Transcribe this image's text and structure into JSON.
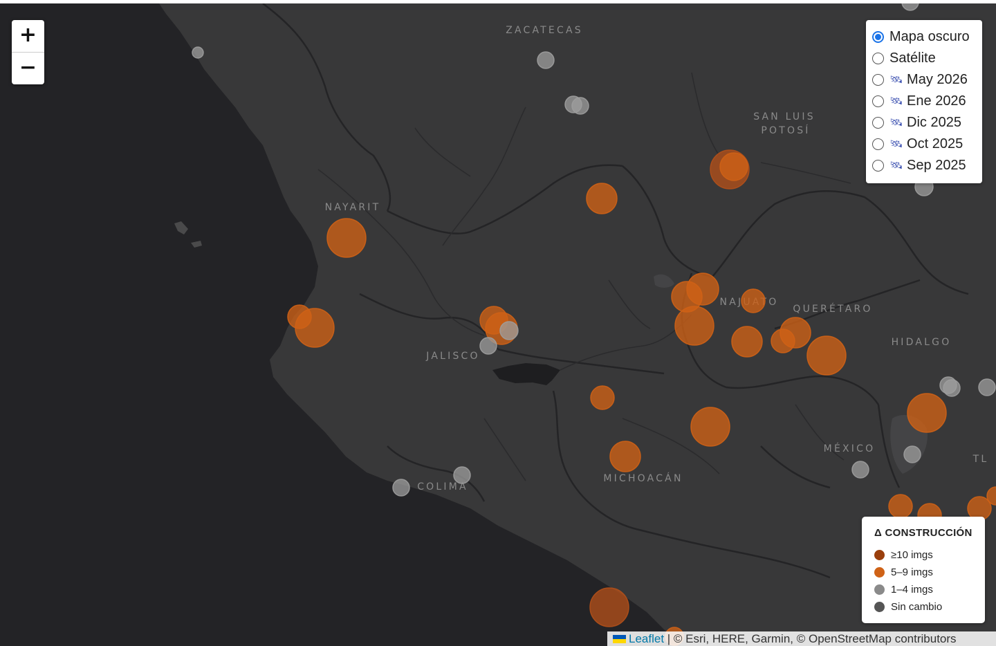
{
  "map": {
    "states": [
      {
        "label": "ZACATECAS",
        "lines": [
          "ZACATECAS"
        ]
      },
      {
        "label": "SAN LUIS POTOSÍ",
        "lines": [
          "SAN LUIS",
          "POTOSÍ"
        ]
      },
      {
        "label": "NAYARIT",
        "lines": [
          "NAYARIT"
        ]
      },
      {
        "label": "GUANAJUATO",
        "lines": [
          "NAJUATO"
        ]
      },
      {
        "label": "QUERÉTARO",
        "lines": [
          "QUERÉTARO"
        ]
      },
      {
        "label": "JALISCO",
        "lines": [
          "JALISCO"
        ]
      },
      {
        "label": "HIDALGO",
        "lines": [
          "HIDALGO"
        ]
      },
      {
        "label": "MÉXICO",
        "lines": [
          "MÉXICO"
        ]
      },
      {
        "label": "MICHOACÁN",
        "lines": [
          "MICHOACÁN"
        ]
      },
      {
        "label": "COLIMA",
        "lines": [
          "COLIMA"
        ]
      },
      {
        "label": "TLAXCALA",
        "lines": [
          "TL"
        ]
      }
    ]
  },
  "zoom": {
    "in_label": "+",
    "out_label": "−"
  },
  "layers": {
    "selected": "Mapa oscuro",
    "items": [
      {
        "label": "Mapa oscuro",
        "icon": "",
        "selected": true
      },
      {
        "label": "Satélite",
        "icon": "",
        "selected": false
      },
      {
        "label": "May 2026",
        "icon": "satellite-icon",
        "selected": false
      },
      {
        "label": "Ene 2026",
        "icon": "satellite-icon",
        "selected": false
      },
      {
        "label": "Dic 2025",
        "icon": "satellite-icon",
        "selected": false
      },
      {
        "label": "Oct 2025",
        "icon": "satellite-icon",
        "selected": false
      },
      {
        "label": "Sep 2025",
        "icon": "satellite-icon",
        "selected": false
      }
    ]
  },
  "legend": {
    "title": "Δ CONSTRUCCIÓN",
    "items": [
      {
        "label": "≥10 imgs",
        "color": "#9a3f0c"
      },
      {
        "label": "5–9 imgs",
        "color": "#cf6216"
      },
      {
        "label": "1–4 imgs",
        "color": "#8a8a8a"
      },
      {
        "label": "Sin cambio",
        "color": "#555555"
      }
    ]
  },
  "attribution": {
    "leaflet": "Leaflet",
    "rest": " | © Esri, HERE, Garmin, © OpenStreetMap contributors"
  },
  "colors": {
    "ocean": "#232326",
    "land": "#383839",
    "lake": "#1e1e20",
    "marker_high": "#b2501a",
    "marker_mid": "#cf6216",
    "marker_low": "#9d9d9d"
  }
}
